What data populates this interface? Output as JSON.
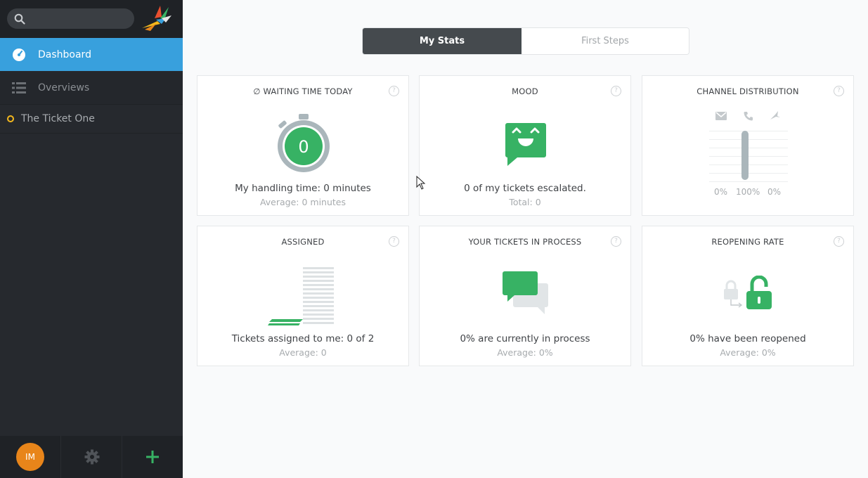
{
  "app": {
    "colors": {
      "sidebar": "#26292e",
      "accent_blue": "#38a0dd",
      "green": "#37b264",
      "orange": "#e8851a",
      "yellow": "#f4b81d"
    }
  },
  "sidebar": {
    "search": {
      "placeholder": "",
      "value": ""
    },
    "nav": [
      {
        "label": "Dashboard",
        "icon": "dashboard-gauge-icon",
        "active": true
      },
      {
        "label": "Overviews",
        "icon": "list-icon",
        "active": false
      }
    ],
    "tickets": [
      {
        "label": "The Ticket One",
        "status_color": "#f4b81d"
      }
    ],
    "footer": {
      "avatar_initials": "IM"
    }
  },
  "tabs": [
    {
      "label": "My Stats",
      "active": true
    },
    {
      "label": "First Steps",
      "active": false
    }
  ],
  "widgets": {
    "waiting": {
      "title": "∅ WAITING TIME TODAY",
      "value": "0",
      "main": "My handling time: 0 minutes",
      "sub": "Average: 0 minutes"
    },
    "mood": {
      "title": "MOOD",
      "main": "0 of my tickets escalated.",
      "sub": "Total: 0"
    },
    "channel": {
      "title": "CHANNEL DISTRIBUTION",
      "channels": [
        {
          "icon": "email-icon",
          "value": "0%",
          "fraction": 0
        },
        {
          "icon": "phone-icon",
          "value": "100%",
          "fraction": 1
        },
        {
          "icon": "twitter-bird-icon",
          "value": "0%",
          "fraction": 0
        }
      ]
    },
    "assigned": {
      "title": "ASSIGNED",
      "main": "Tickets assigned to me: 0 of 2",
      "sub": "Average: 0"
    },
    "in_process": {
      "title": "YOUR TICKETS IN PROCESS",
      "main": "0% are currently in process",
      "sub": "Average: 0%"
    },
    "reopening": {
      "title": "REOPENING RATE",
      "main": "0% have been reopened",
      "sub": "Average: 0%"
    }
  },
  "help_glyph": "?"
}
